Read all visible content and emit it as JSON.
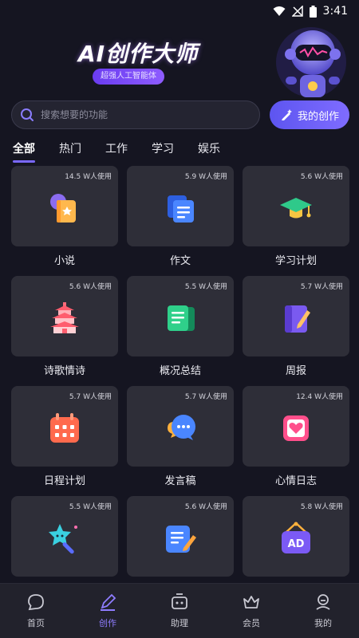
{
  "status": {
    "time": "3:41"
  },
  "hero": {
    "title": "AI创作大师",
    "badge": "超强人工智能体"
  },
  "search": {
    "placeholder": "搜索想要的功能"
  },
  "my_create": {
    "label": "我的创作"
  },
  "tabs": [
    {
      "label": "全部",
      "active": true
    },
    {
      "label": "热门"
    },
    {
      "label": "工作"
    },
    {
      "label": "学习"
    },
    {
      "label": "娱乐"
    }
  ],
  "features": [
    {
      "label": "小说",
      "usage": "14.5 W人使用",
      "icon": "book-icon"
    },
    {
      "label": "作文",
      "usage": "5.9 W人使用",
      "icon": "document-icon"
    },
    {
      "label": "学习计划",
      "usage": "5.6 W人使用",
      "icon": "graduation-cap-icon"
    },
    {
      "label": "诗歌情诗",
      "usage": "5.6 W人使用",
      "icon": "pagoda-icon"
    },
    {
      "label": "概况总结",
      "usage": "5.5 W人使用",
      "icon": "notes-icon"
    },
    {
      "label": "周报",
      "usage": "5.7 W人使用",
      "icon": "notebook-pen-icon"
    },
    {
      "label": "日程计划",
      "usage": "5.7 W人使用",
      "icon": "calendar-icon"
    },
    {
      "label": "发言稿",
      "usage": "5.7 W人使用",
      "icon": "chat-bubbles-icon"
    },
    {
      "label": "心情日志",
      "usage": "12.4 W人使用",
      "icon": "heart-diary-icon"
    },
    {
      "label": "",
      "usage": "5.5 W人使用",
      "icon": "magic-wand-icon"
    },
    {
      "label": "",
      "usage": "5.6 W人使用",
      "icon": "copywriting-icon"
    },
    {
      "label": "",
      "usage": "5.8 W人使用",
      "icon": "ad-sign-icon"
    }
  ],
  "nav": [
    {
      "label": "首页",
      "icon": "chat-home-icon"
    },
    {
      "label": "创作",
      "icon": "pen-icon",
      "active": true
    },
    {
      "label": "助理",
      "icon": "robot-icon"
    },
    {
      "label": "会员",
      "icon": "crown-icon"
    },
    {
      "label": "我的",
      "icon": "profile-icon"
    }
  ],
  "colors": {
    "background": "#151521",
    "card": "#2e2e38",
    "accent": "#7a68ff",
    "nav_active": "#8f7dff"
  }
}
